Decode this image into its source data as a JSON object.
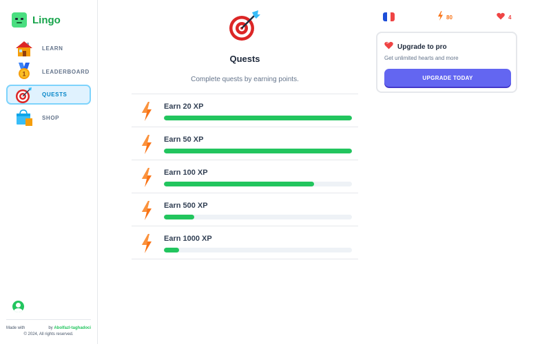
{
  "brand": {
    "name": "Lingo"
  },
  "sidebar": {
    "items": [
      {
        "label": "LEARN",
        "icon": "house-icon"
      },
      {
        "label": "LEADERBOARD",
        "icon": "medal-icon"
      },
      {
        "label": "QUESTS",
        "icon": "target-icon",
        "active": true
      },
      {
        "label": "SHOP",
        "icon": "shopping-bag-icon"
      }
    ]
  },
  "footer": {
    "made_with": "Made with",
    "by_text": "by",
    "author": "Abolfazl-taghadoci",
    "copyright": "© 2024, All rights reserved."
  },
  "page": {
    "icon": "target-icon",
    "title": "Quests",
    "subtitle": "Complete quests by earning points."
  },
  "quests": [
    {
      "label": "Earn 20 XP",
      "progress": 1.0
    },
    {
      "label": "Earn 50 XP",
      "progress": 1.0
    },
    {
      "label": "Earn 100 XP",
      "progress": 0.8
    },
    {
      "label": "Earn 500 XP",
      "progress": 0.16
    },
    {
      "label": "Earn 1000 XP",
      "progress": 0.08
    }
  ],
  "stats": {
    "language_flag": "france-flag-icon",
    "points": "80",
    "hearts": "4"
  },
  "promo": {
    "title": "Upgrade to pro",
    "text": "Get unlimited hearts and more",
    "button": "UPGRADE TODAY"
  },
  "colors": {
    "brand": "#16a34a",
    "progress": "#22c55e",
    "active_nav_bg": "#e0f2fe",
    "active_nav_border": "#7dd3fc",
    "button": "#6366f1",
    "points": "#f97316",
    "hearts": "#ef4444"
  }
}
